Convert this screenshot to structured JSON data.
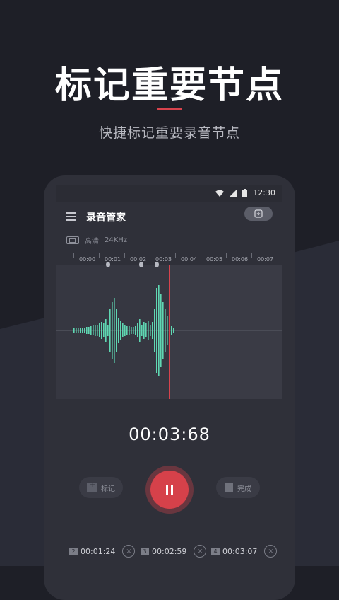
{
  "headline": "标记重要节点",
  "subheadline": "快捷标记重要录音节点",
  "status_bar": {
    "time": "12:30"
  },
  "app": {
    "title": "录音管家",
    "quality_label": "高清",
    "quality_value": "24KHz"
  },
  "timeline": {
    "ticks": [
      "00:00",
      "00:01",
      "00:02",
      "00:03",
      "00:04",
      "00:05",
      "00:06",
      "00:07"
    ]
  },
  "recording": {
    "elapsed": "00:03:68"
  },
  "controls": {
    "mark_label": "标记",
    "done_label": "完成"
  },
  "marks": [
    {
      "index": "2",
      "time": "00:01:24"
    },
    {
      "index": "3",
      "time": "00:02:59"
    },
    {
      "index": "4",
      "time": "00:03:07"
    }
  ],
  "colors": {
    "accent_red": "#d6414a",
    "wave_green": "#5fd7b2",
    "background": "#1e1f27"
  }
}
